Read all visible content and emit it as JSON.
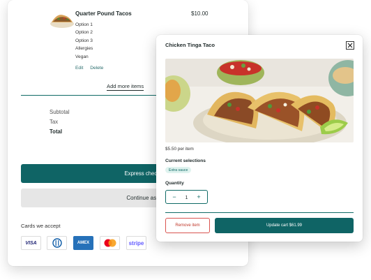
{
  "cart": {
    "item": {
      "name": "Quarter Pound Tacos",
      "price": "$10.00",
      "options": [
        "Option 1",
        "Option 2",
        "Option 3",
        "Allergies",
        "Vegan"
      ],
      "edit_label": "Edit",
      "delete_label": "Delete"
    },
    "add_more_label": "Add more items",
    "summary": {
      "subtotal_label": "Subtotal",
      "tax_label": "Tax",
      "total_label": "Total"
    },
    "express_checkout_label": "Express checkout with Pal",
    "guest_label": "Continue as a guest",
    "cards_label": "Cards we accept",
    "cards": [
      {
        "name": "visa-logo",
        "text": "VISA"
      },
      {
        "name": "diners-logo",
        "text": ""
      },
      {
        "name": "amex-logo",
        "text": "AMEX"
      },
      {
        "name": "mastercard-logo",
        "text": ""
      },
      {
        "name": "stripe-logo",
        "text": "stripe"
      }
    ]
  },
  "modal": {
    "title": "Chicken Tinga Taco",
    "price_per_item": "$5.50 per item",
    "current_selections_label": "Current selections",
    "selection_badge": "Extra sauce",
    "quantity_label": "Quantity",
    "quantity_value": "1",
    "minus_symbol": "−",
    "plus_symbol": "+",
    "remove_label": "Remove item",
    "update_label": "Update cart $61.99"
  },
  "colors": {
    "brand_teal": "#0f6465",
    "remove_red": "#d9534f",
    "badge_bg": "#dff3ef"
  }
}
